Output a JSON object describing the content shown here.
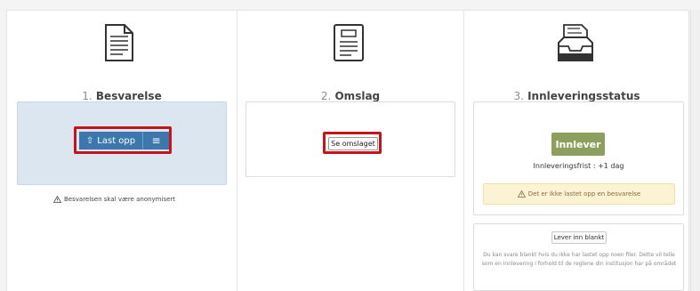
{
  "steps": [
    {
      "number": "1.",
      "title": "Besvarelse",
      "icon": "document-icon"
    },
    {
      "number": "2.",
      "title": "Omslag",
      "icon": "cover-page-icon"
    },
    {
      "number": "3.",
      "title": "Innleveringsstatus",
      "icon": "inbox-tray-icon"
    }
  ],
  "upload": {
    "upload_label": "Last opp",
    "upload_icon_glyph": "⇧",
    "menu_glyph": "≡",
    "anonymize_note": "Besvarelsen skal være anonymisert"
  },
  "cover": {
    "view_label": "Se omslaget"
  },
  "status": {
    "submit_label": "Innlever",
    "deadline": "Innleveringsfrist : +1 dag",
    "warning": "Det er ikke lastet opp en besvarelse",
    "blank_button_label": "Lever inn blankt",
    "blank_text": "Du kan svare blankt hvis du ikke har lastet opp noen filer. Dette vil telle som en innlevering i forhold til de reglene din institusjon har på området"
  },
  "colors": {
    "primary_blue": "#3c77ae",
    "highlight_red": "#c4151c",
    "submit_green": "#8d9f5e",
    "warning_bg": "#fcf2d4"
  }
}
